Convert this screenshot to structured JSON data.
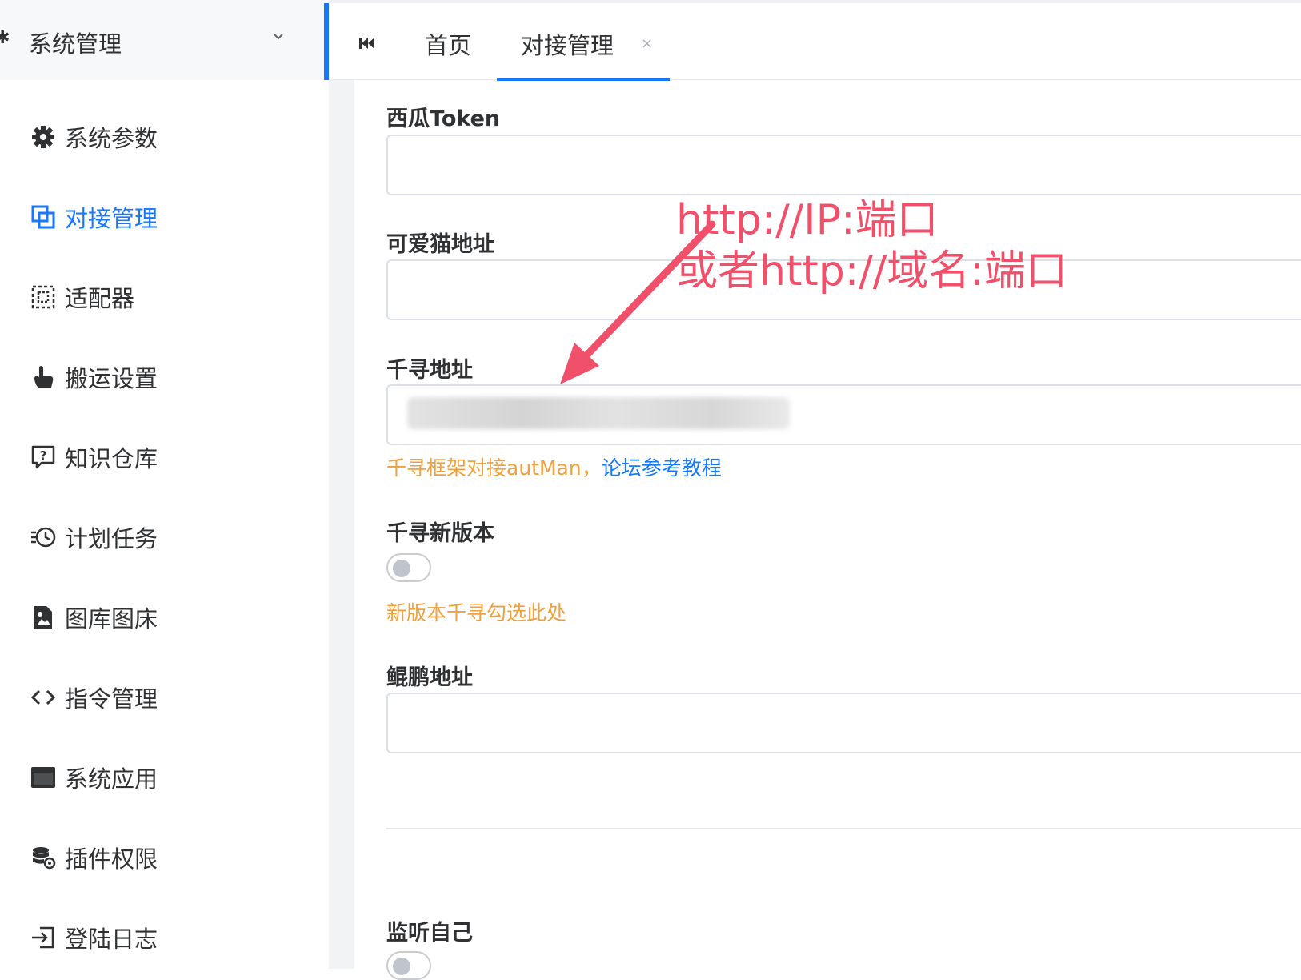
{
  "sidebar": {
    "header": {
      "label": "系统管理",
      "icon": "gear-icon"
    },
    "items": [
      {
        "label": "系统参数",
        "icon": "gear-icon",
        "active": false
      },
      {
        "label": "对接管理",
        "icon": "link-squares-icon",
        "active": true
      },
      {
        "label": "适配器",
        "icon": "dashed-plugin-icon",
        "active": false
      },
      {
        "label": "搬运设置",
        "icon": "pointer-hand-icon",
        "active": false
      },
      {
        "label": "知识仓库",
        "icon": "question-bubble-icon",
        "active": false
      },
      {
        "label": "计划任务",
        "icon": "clock-list-icon",
        "active": false
      },
      {
        "label": "图库图床",
        "icon": "image-file-icon",
        "active": false
      },
      {
        "label": "指令管理",
        "icon": "code-brackets-icon",
        "active": false
      },
      {
        "label": "系统应用",
        "icon": "window-app-icon",
        "active": false
      },
      {
        "label": "插件权限",
        "icon": "database-lock-icon",
        "active": false
      },
      {
        "label": "登陆日志",
        "icon": "login-icon",
        "active": false
      }
    ]
  },
  "tabs": {
    "home": "首页",
    "active": "对接管理",
    "close": "×"
  },
  "form": {
    "xigua_token": {
      "label": "西瓜Token",
      "value": ""
    },
    "keai_mao": {
      "label": "可爱猫地址",
      "value": ""
    },
    "qianxun": {
      "label": "千寻地址",
      "hint_prefix": "千寻框架对接autMan，",
      "hint_link": "论坛参考教程"
    },
    "qianxun_new": {
      "label": "千寻新版本",
      "enabled": false,
      "hint": "新版本千寻勾选此处"
    },
    "kunpeng": {
      "label": "鲲鹏地址",
      "value": ""
    },
    "listen_self": {
      "label": "监听自己",
      "enabled": false
    }
  },
  "annotation": {
    "line1": "http://IP:端口",
    "line2": "或者http://域名:端口",
    "color": "#f0506a"
  },
  "colors": {
    "accent": "#1677ff",
    "hint": "#f0a03c"
  }
}
